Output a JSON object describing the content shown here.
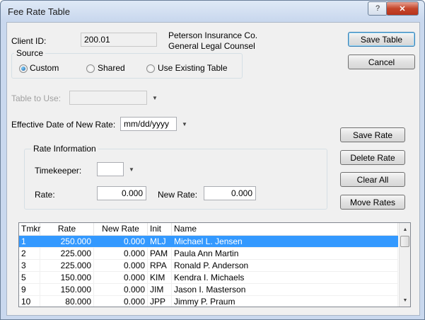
{
  "window": {
    "title": "Fee Rate Table",
    "help_label": "?",
    "close_label": "✕"
  },
  "client": {
    "id_label": "Client ID:",
    "id_value": "200.01",
    "company": "Peterson Insurance Co.",
    "description": "General Legal Counsel"
  },
  "source": {
    "title": "Source",
    "options": [
      "Custom",
      "Shared",
      "Use Existing Table"
    ],
    "selected": "Custom"
  },
  "table_to_use": {
    "label": "Table to Use:",
    "value": ""
  },
  "effective": {
    "label": "Effective Date of New Rate:",
    "value": "mm/dd/yyyy"
  },
  "rate_info": {
    "title": "Rate Information",
    "timekeeper_label": "Timekeeper:",
    "timekeeper_value": "",
    "rate_label": "Rate:",
    "rate_value": "0.000",
    "new_rate_label": "New Rate:",
    "new_rate_value": "0.000"
  },
  "buttons": {
    "save_table": "Save Table",
    "cancel": "Cancel",
    "save_rate": "Save Rate",
    "delete_rate": "Delete Rate",
    "clear_all": "Clear All",
    "move_rates": "Move Rates"
  },
  "list": {
    "headers": [
      "Tmkr",
      "Rate",
      "New Rate",
      "Init",
      "Name"
    ],
    "rows": [
      {
        "tmkr": "1",
        "rate": "250.000",
        "new_rate": "0.000",
        "init": "MLJ",
        "name": "Michael L. Jensen",
        "selected": true
      },
      {
        "tmkr": "2",
        "rate": "225.000",
        "new_rate": "0.000",
        "init": "PAM",
        "name": "Paula Ann Martin"
      },
      {
        "tmkr": "3",
        "rate": "225.000",
        "new_rate": "0.000",
        "init": "RPA",
        "name": "Ronald P. Anderson"
      },
      {
        "tmkr": "5",
        "rate": "150.000",
        "new_rate": "0.000",
        "init": "KIM",
        "name": "Kendra I. Michaels"
      },
      {
        "tmkr": "9",
        "rate": "150.000",
        "new_rate": "0.000",
        "init": "JIM",
        "name": "Jason I. Masterson"
      },
      {
        "tmkr": "10",
        "rate": "80.000",
        "new_rate": "0.000",
        "init": "JPP",
        "name": "Jimmy P. Praum"
      }
    ]
  }
}
